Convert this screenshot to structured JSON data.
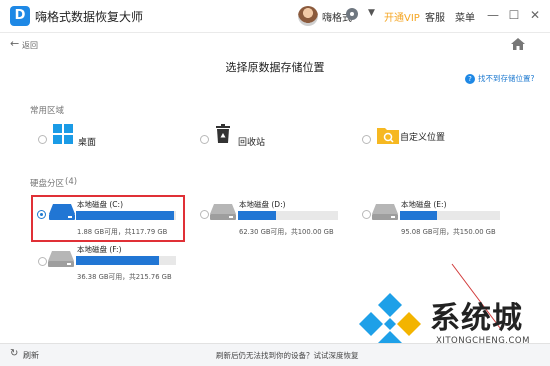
{
  "app": {
    "logo_letter": "D",
    "title": "嗨格式数据恢复大师",
    "username": "嗨格式",
    "vip_label": "开通VIP",
    "service_label": "客服",
    "menu_label": "菜单",
    "minimize": "—",
    "maximize": "☐",
    "close": "✕"
  },
  "nav": {
    "back_label": "返回",
    "page_title": "选择原数据存储位置",
    "help_link": "找不到存储位置?"
  },
  "common": {
    "section_label": "常用区域",
    "items": [
      {
        "label": "桌面",
        "icon": "windows-icon"
      },
      {
        "label": "回收站",
        "icon": "recycle-bin-icon"
      },
      {
        "label": "自定义位置",
        "icon": "folder-search-icon"
      }
    ]
  },
  "disks": {
    "section_label": "硬盘分区",
    "count": "(4)",
    "items": [
      {
        "name": "本地磁盘 (C:)",
        "size": "1.88 GB可用，共117.79 GB",
        "used_fraction": 0.98,
        "selected": true
      },
      {
        "name": "本地磁盘 (D:)",
        "size": "62.30 GB可用，共100.00 GB",
        "used_fraction": 0.38,
        "selected": false
      },
      {
        "name": "本地磁盘 (E:)",
        "size": "95.08 GB可用，共150.00 GB",
        "used_fraction": 0.37,
        "selected": false
      },
      {
        "name": "本地磁盘 (F:)",
        "size": "36.38 GB可用，共215.76 GB",
        "used_fraction": 0.83,
        "selected": false
      }
    ]
  },
  "footer": {
    "refresh_label": "刷新",
    "tip": "刷新后仍无法找到你的设备？试试深度恢复"
  },
  "watermark": {
    "text": "系统城",
    "sub": "XITONGCHENG.COM"
  },
  "colors": {
    "accent": "#2176d4",
    "vip": "#f5a623",
    "highlight": "#e03036"
  }
}
